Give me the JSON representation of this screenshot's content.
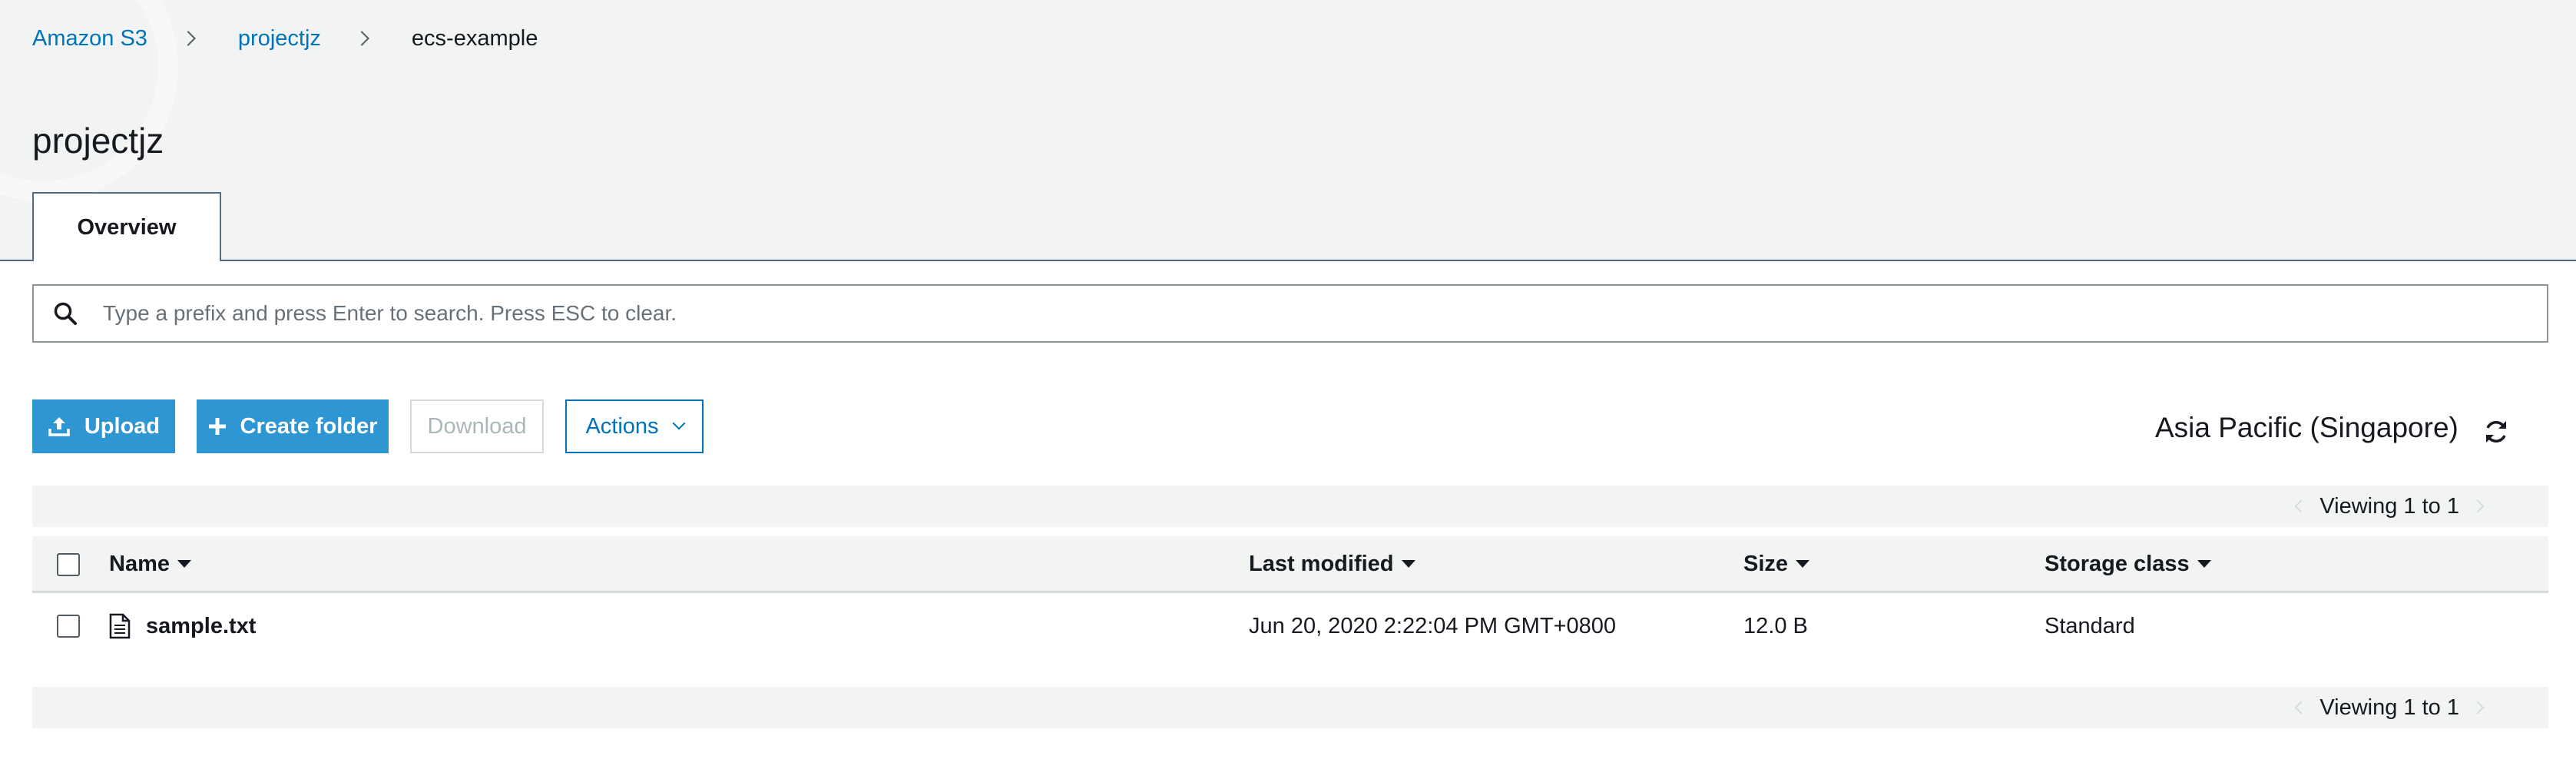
{
  "breadcrumb": {
    "items": [
      {
        "label": "Amazon S3"
      },
      {
        "label": "projectjz"
      },
      {
        "label": "ecs-example"
      }
    ]
  },
  "page": {
    "title": "projectjz"
  },
  "tabs": [
    {
      "label": "Overview",
      "active": true
    }
  ],
  "search": {
    "placeholder": "Type a prefix and press Enter to search. Press ESC to clear.",
    "value": ""
  },
  "toolbar": {
    "upload_label": "Upload",
    "create_folder_label": "Create folder",
    "download_label": "Download",
    "actions_label": "Actions"
  },
  "region": {
    "label": "Asia Pacific (Singapore)"
  },
  "pager": {
    "top_text": "Viewing 1 to 1",
    "bottom_text": "Viewing 1 to 1"
  },
  "table": {
    "columns": [
      "Name",
      "Last modified",
      "Size",
      "Storage class"
    ],
    "rows": [
      {
        "name": "sample.txt",
        "last_modified": "Jun 20, 2020 2:22:04 PM GMT+0800",
        "size": "12.0 B",
        "storage_class": "Standard"
      }
    ]
  },
  "icons": {
    "search": "search-icon",
    "upload": "upload-icon",
    "create_folder": "plus-icon",
    "actions": "chevron-down-icon",
    "refresh": "refresh-icon",
    "file": "file-icon",
    "sort": "caret-down-icon"
  },
  "colors": {
    "link": "#0073bb",
    "primary_button": "#2e96d3",
    "header_background": "#f2f3f3",
    "tab_border": "#546b84"
  }
}
